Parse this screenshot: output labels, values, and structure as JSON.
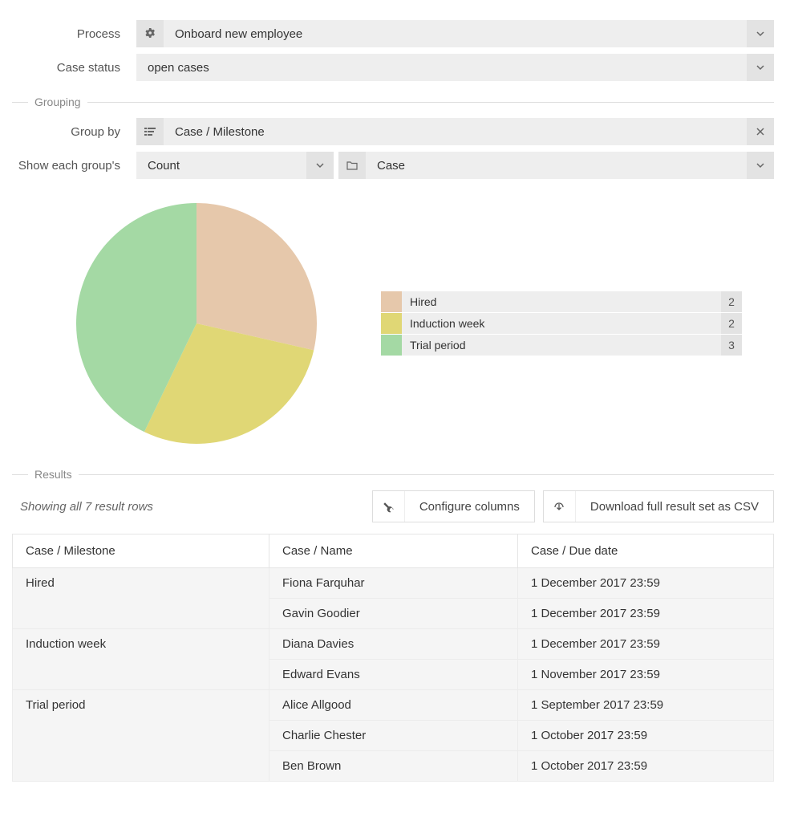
{
  "filters": {
    "process_label": "Process",
    "process_value": "Onboard new employee",
    "status_label": "Case status",
    "status_value": "open cases"
  },
  "grouping": {
    "section_title": "Grouping",
    "group_by_label": "Group by",
    "group_by_value": "Case / Milestone",
    "show_each_label": "Show each group's",
    "agg_value": "Count",
    "entity_value": "Case"
  },
  "chart_data": {
    "type": "pie",
    "title": "",
    "series": [
      {
        "name": "Hired",
        "value": 2,
        "color": "#e6c8ab"
      },
      {
        "name": "Induction week",
        "value": 2,
        "color": "#e0d775"
      },
      {
        "name": "Trial period",
        "value": 3,
        "color": "#a4d9a4"
      }
    ],
    "total": 7
  },
  "results": {
    "section_title": "Results",
    "caption": "Showing all 7 result rows",
    "configure_label": "Configure columns",
    "download_label": "Download full result set as CSV",
    "columns": [
      "Case / Milestone",
      "Case / Name",
      "Case / Due date"
    ],
    "groups": [
      {
        "milestone": "Hired",
        "rows": [
          {
            "name": "Fiona Farquhar",
            "due": "1 December 2017 23:59"
          },
          {
            "name": "Gavin Goodier",
            "due": "1 December 2017 23:59"
          }
        ]
      },
      {
        "milestone": "Induction week",
        "rows": [
          {
            "name": "Diana Davies",
            "due": "1 December 2017 23:59"
          },
          {
            "name": "Edward Evans",
            "due": "1 November 2017 23:59"
          }
        ]
      },
      {
        "milestone": "Trial period",
        "rows": [
          {
            "name": "Alice Allgood",
            "due": "1 September 2017 23:59"
          },
          {
            "name": "Charlie Chester",
            "due": "1 October 2017 23:59"
          },
          {
            "name": "Ben Brown",
            "due": "1 October 2017 23:59"
          }
        ]
      }
    ]
  }
}
